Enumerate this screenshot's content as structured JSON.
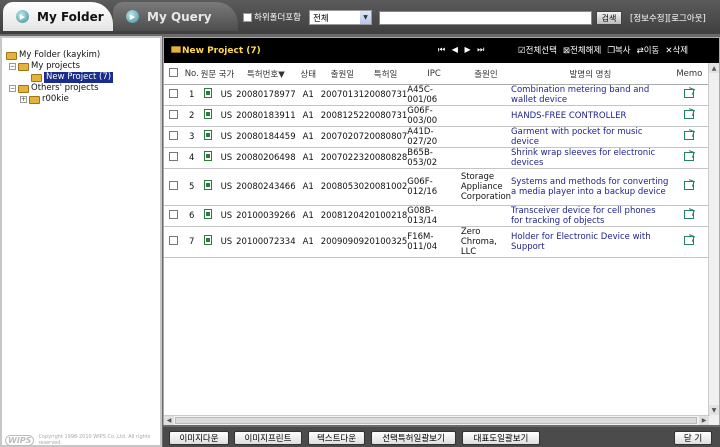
{
  "tabs": {
    "my_folder": "My Folder",
    "my_query": "My Query"
  },
  "toolbar": {
    "include_subfolders": "하위폴더포함",
    "scope_value": "전체",
    "search_button": "검색",
    "edit_info": "[정보수정]",
    "logout": "[로그아웃]"
  },
  "tree": {
    "root": "My Folder (kaykim)",
    "my_projects": "My projects",
    "new_project": "New Project  (7)",
    "others_projects": "Others' projects",
    "user": "r00kie"
  },
  "copyright": {
    "logo": "WIPS",
    "text": "Copyright 1998-2010 WIPS Co.,Ltd. All rights reserved."
  },
  "panel": {
    "title": "New Project (7)",
    "nav": "⏮ ◀ ▶ ⏭",
    "select_all": "전체선택",
    "deselect_all": "전체해제",
    "copy": "복사",
    "move": "이동",
    "delete": "삭제"
  },
  "table": {
    "headers": [
      "No.",
      "원문",
      "국가",
      "특허번호▼",
      "상태",
      "출원일",
      "특허일",
      "IPC",
      "출원인",
      "발명의 명칭",
      "Memo"
    ],
    "rows": [
      {
        "no": "1",
        "country": "US",
        "patent": "20080178977",
        "status": "A1",
        "filed": "20070131",
        "issued": "20080731",
        "ipc": "A45C-001/06",
        "applicant": "",
        "title": "Combination metering band and wallet device"
      },
      {
        "no": "2",
        "country": "US",
        "patent": "20080183911",
        "status": "A1",
        "filed": "20081252",
        "issued": "20080731",
        "ipc": "G06F-003/00",
        "applicant": "",
        "title": "HANDS-FREE CONTROLLER"
      },
      {
        "no": "3",
        "country": "US",
        "patent": "20080184459",
        "status": "A1",
        "filed": "20070207",
        "issued": "20080807",
        "ipc": "A41D-027/20",
        "applicant": "",
        "title": "Garment with pocket for music device"
      },
      {
        "no": "4",
        "country": "US",
        "patent": "20080206498",
        "status": "A1",
        "filed": "20070223",
        "issued": "20080828",
        "ipc": "B65B-053/02",
        "applicant": "",
        "title": "Shrink wrap sleeves for electronic devices"
      },
      {
        "no": "5",
        "country": "US",
        "patent": "20080243466",
        "status": "A1",
        "filed": "20080530",
        "issued": "20081002",
        "ipc": "G06F-012/16",
        "applicant": "Storage Appliance Corporation",
        "title": "Systems and methods for converting a media player into a backup device"
      },
      {
        "no": "6",
        "country": "US",
        "patent": "20100039266",
        "status": "A1",
        "filed": "20081204",
        "issued": "20100218",
        "ipc": "G08B-013/14",
        "applicant": "",
        "title": "Transceiver device for cell phones for tracking of objects"
      },
      {
        "no": "7",
        "country": "US",
        "patent": "20100072334",
        "status": "A1",
        "filed": "20090909",
        "issued": "20100325",
        "ipc": "F16M-011/04",
        "applicant": "Zero Chroma, LLC",
        "title": "Holder for Electronic Device with Support"
      }
    ]
  },
  "bottom": {
    "image_download": "이미지다운",
    "image_print": "이미지프린트",
    "text_download": "텍스트다운",
    "selected_summary": "선택특허일괄보기",
    "rep_drawings": "대표도일괄보기",
    "close": "닫 기"
  }
}
